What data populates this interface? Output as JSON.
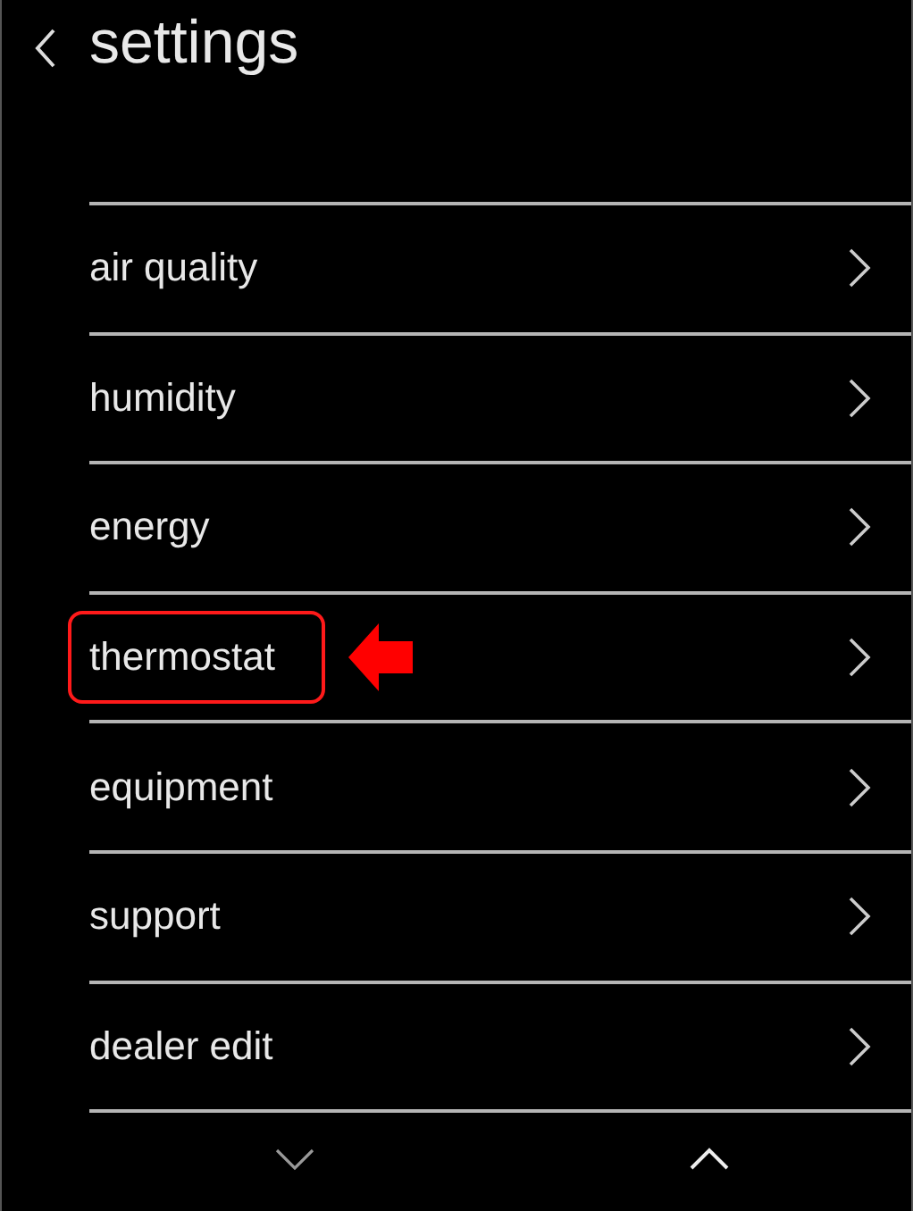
{
  "header": {
    "title": "settings"
  },
  "items": [
    {
      "label": "air quality",
      "highlighted": false
    },
    {
      "label": "humidity",
      "highlighted": false
    },
    {
      "label": "energy",
      "highlighted": false
    },
    {
      "label": "thermostat",
      "highlighted": true
    },
    {
      "label": "equipment",
      "highlighted": false
    },
    {
      "label": "support",
      "highlighted": false
    },
    {
      "label": "dealer edit",
      "highlighted": false
    }
  ]
}
